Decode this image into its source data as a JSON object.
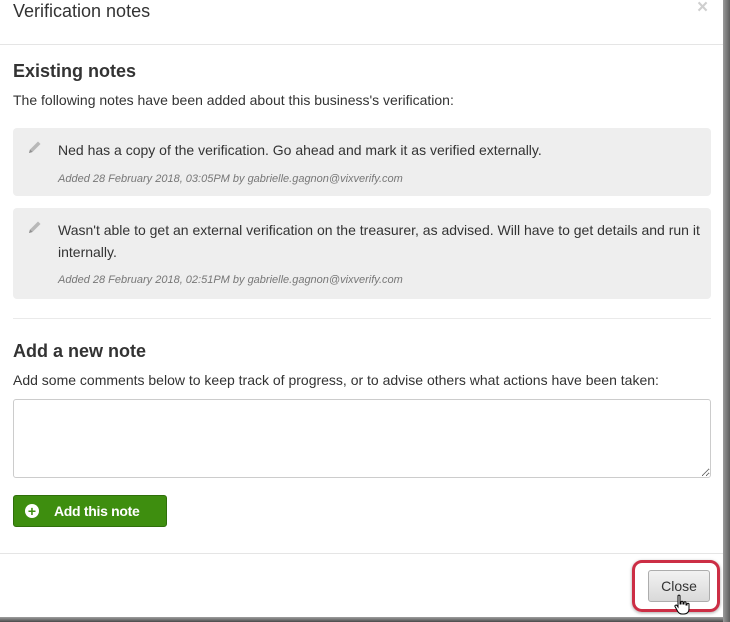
{
  "modal": {
    "title": "Verification notes",
    "close_symbol": "×"
  },
  "existing": {
    "heading": "Existing notes",
    "description": "The following notes have been added about this business's verification:",
    "notes": [
      {
        "text": "Ned has a copy of the verification. Go ahead and mark it as verified externally.",
        "meta": "Added 28 February 2018, 03:05PM by gabrielle.gagnon@vixverify.com",
        "icon": "pencil-icon"
      },
      {
        "text": "Wasn't able to get an external verification on the treasurer, as advised. Will have to get details and run it internally.",
        "meta": "Added 28 February 2018, 02:51PM by gabrielle.gagnon@vixverify.com",
        "icon": "pencil-icon"
      }
    ]
  },
  "add_note": {
    "heading": "Add a new note",
    "description": "Add some comments below to keep track of progress, or to advise others what actions have been taken:",
    "textarea_value": "",
    "button_label": "Add this note",
    "button_icon": "plus-circle-icon"
  },
  "footer": {
    "close_label": "Close"
  },
  "colors": {
    "add_button": "#3e8e0f",
    "highlight_ring": "#cc2e45",
    "note_background": "#eeeeee"
  }
}
